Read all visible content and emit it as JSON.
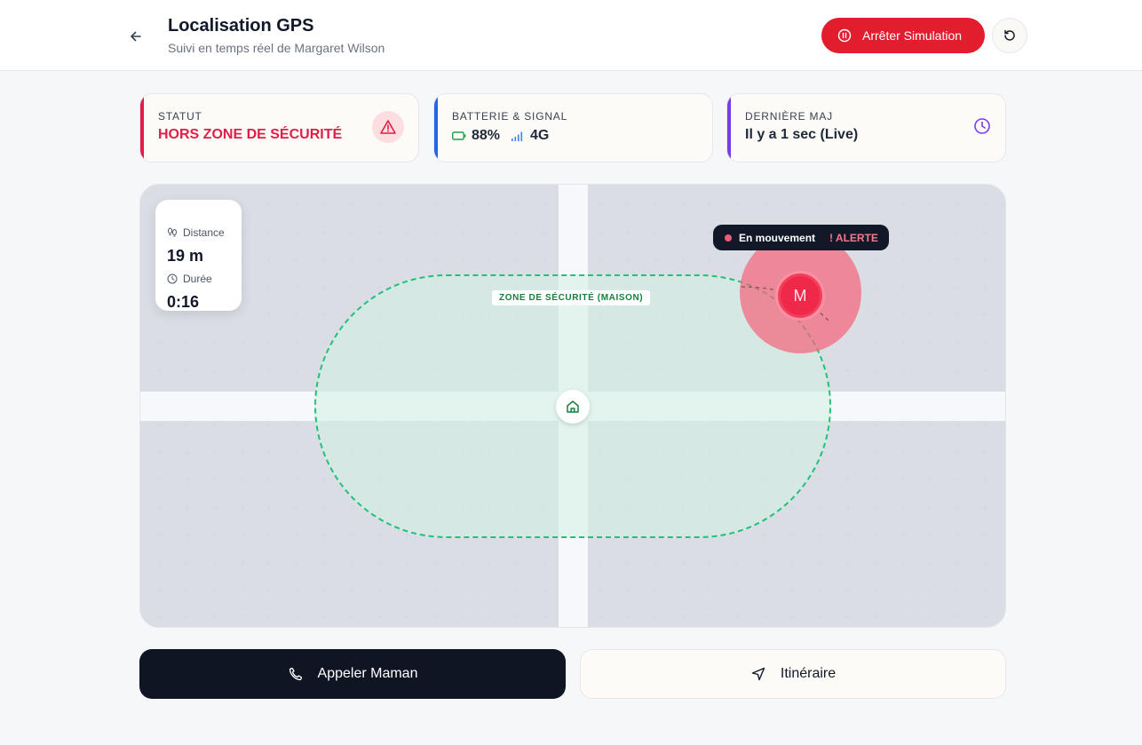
{
  "header": {
    "title": "Localisation GPS",
    "subtitle": "Suivi en temps réel de Margaret Wilson",
    "stop_label": "Arrêter Simulation"
  },
  "cards": {
    "status": {
      "label": "STATUT",
      "value": "HORS ZONE DE SÉCURITÉ",
      "color": "#e11d48"
    },
    "battery": {
      "label": "BATTERIE & SIGNAL",
      "battery": "88%",
      "signal": "4G",
      "color": "#2563eb"
    },
    "update": {
      "label": "DERNIÈRE MAJ",
      "value": "Il y a 1 sec (Live)",
      "color": "#7c3aed"
    }
  },
  "map": {
    "zone_label": "ZONE DE SÉCURITÉ (MAISON)",
    "stats": {
      "distance_label": "Distance",
      "distance_value": "19 m",
      "duration_label": "Durée",
      "duration_value": "0:16"
    },
    "person": {
      "initial": "M",
      "status": "En mouvement",
      "alert": "! ALERTE"
    }
  },
  "actions": {
    "call_label": "Appeler Maman",
    "route_label": "Itinéraire"
  }
}
